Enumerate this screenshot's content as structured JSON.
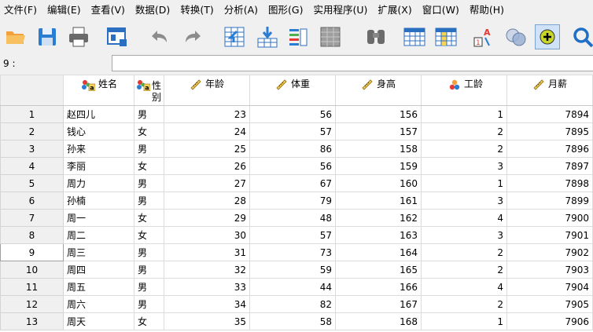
{
  "menubar": {
    "items": [
      "文件(F)",
      "编辑(E)",
      "查看(V)",
      "数据(D)",
      "转换(T)",
      "分析(A)",
      "图形(G)",
      "实用程序(U)",
      "扩展(X)",
      "窗口(W)",
      "帮助(H)"
    ]
  },
  "toolbar": {
    "buttons": [
      "open-folder-icon",
      "save-icon",
      "print-icon",
      "recall-dialog-icon",
      "undo-icon",
      "redo-icon",
      "goto-case-icon",
      "goto-variable-icon",
      "variables-icon",
      "run-descriptives-icon",
      "find-icon",
      "insert-cases-icon",
      "insert-variable-icon",
      "split-file-icon",
      "weight-cases-icon",
      "select-cases-icon",
      "value-labels-icon",
      "search-icon"
    ]
  },
  "cellbar": {
    "ref": "9 :",
    "value": ""
  },
  "columns": [
    {
      "name": "姓名",
      "type": "nominal",
      "align": "left"
    },
    {
      "name": "性别",
      "type": "nominal",
      "align": "left"
    },
    {
      "name": "年龄",
      "type": "scale",
      "align": "right"
    },
    {
      "name": "体重",
      "type": "scale",
      "align": "right"
    },
    {
      "name": "身高",
      "type": "scale",
      "align": "right"
    },
    {
      "name": "工龄",
      "type": "ordinal",
      "align": "right"
    },
    {
      "name": "月薪",
      "type": "scale",
      "align": "right"
    }
  ],
  "selected_row": 9,
  "rows": [
    {
      "n": "1",
      "cells": [
        "赵四儿",
        "男",
        "23",
        "56",
        "156",
        "1",
        "7894"
      ]
    },
    {
      "n": "2",
      "cells": [
        "钱心",
        "女",
        "24",
        "57",
        "157",
        "2",
        "7895"
      ]
    },
    {
      "n": "3",
      "cells": [
        "孙来",
        "男",
        "25",
        "86",
        "158",
        "2",
        "7896"
      ]
    },
    {
      "n": "4",
      "cells": [
        "李丽",
        "女",
        "26",
        "56",
        "159",
        "3",
        "7897"
      ]
    },
    {
      "n": "5",
      "cells": [
        "周力",
        "男",
        "27",
        "67",
        "160",
        "1",
        "7898"
      ]
    },
    {
      "n": "6",
      "cells": [
        "孙楠",
        "男",
        "28",
        "79",
        "161",
        "3",
        "7899"
      ]
    },
    {
      "n": "7",
      "cells": [
        "周一",
        "女",
        "29",
        "48",
        "162",
        "4",
        "7900"
      ]
    },
    {
      "n": "8",
      "cells": [
        "周二",
        "女",
        "30",
        "57",
        "163",
        "3",
        "7901"
      ]
    },
    {
      "n": "9",
      "cells": [
        "周三",
        "男",
        "31",
        "73",
        "164",
        "2",
        "7902"
      ]
    },
    {
      "n": "10",
      "cells": [
        "周四",
        "男",
        "32",
        "59",
        "165",
        "2",
        "7903"
      ]
    },
    {
      "n": "11",
      "cells": [
        "周五",
        "男",
        "33",
        "44",
        "166",
        "4",
        "7904"
      ]
    },
    {
      "n": "12",
      "cells": [
        "周六",
        "男",
        "34",
        "82",
        "167",
        "2",
        "7905"
      ]
    },
    {
      "n": "13",
      "cells": [
        "周天",
        "女",
        "35",
        "58",
        "168",
        "1",
        "7906"
      ]
    }
  ]
}
